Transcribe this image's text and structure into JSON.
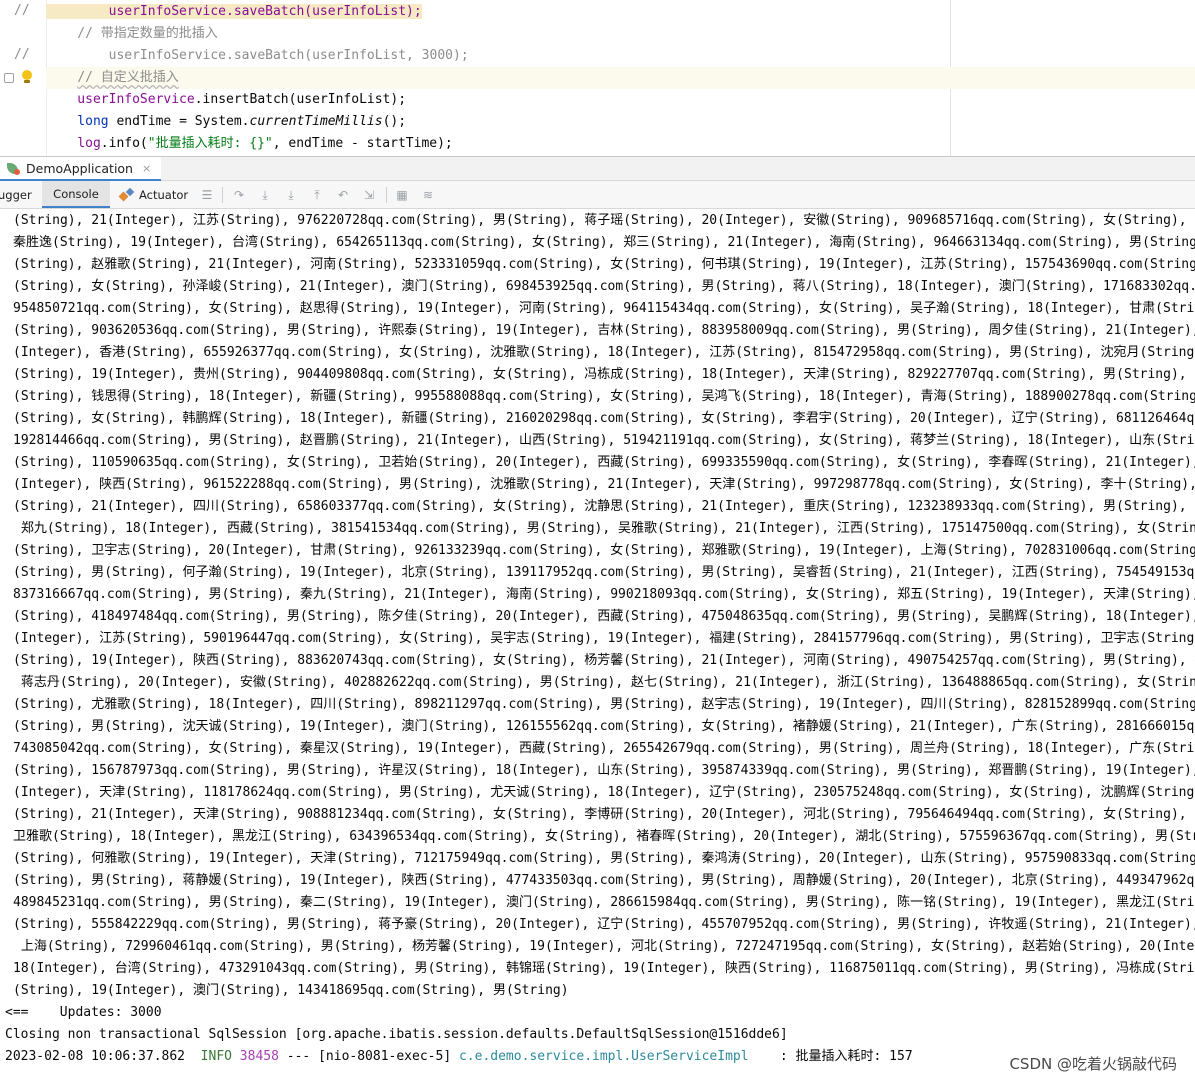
{
  "editor": {
    "lines": [
      {
        "gutter": "//",
        "parts": [
          {
            "cls": "c-field c-hl",
            "text": "        userInfoService.saveBatch(userInfoList);"
          }
        ]
      },
      {
        "gutter": "",
        "parts": [
          {
            "cls": "c-comment",
            "text": "    // 带指定数量的批插入"
          }
        ]
      },
      {
        "gutter": "//",
        "parts": [
          {
            "cls": "c-comment",
            "text": "        userInfoService.saveBatch(userInfoList, 3000);"
          }
        ]
      },
      {
        "gutter": "",
        "current": true,
        "parts": [
          {
            "cls": "c-comment",
            "text": "    "
          },
          {
            "cls": "c-comment squiggle",
            "text": "// 自定义批插入"
          }
        ]
      },
      {
        "gutter": "",
        "parts": [
          {
            "cls": "c-field",
            "text": "    userInfoService"
          },
          {
            "cls": "c-plain",
            "text": ".insertBatch(userInfoList);"
          }
        ]
      },
      {
        "gutter": "",
        "parts": [
          {
            "cls": "c-kw",
            "text": "    long"
          },
          {
            "cls": "c-plain",
            "text": " endTime = System."
          },
          {
            "cls": "c-static",
            "text": "currentTimeMillis"
          },
          {
            "cls": "c-plain",
            "text": "();"
          }
        ]
      },
      {
        "gutter": "",
        "parts": [
          {
            "cls": "c-field",
            "text": "    log"
          },
          {
            "cls": "c-plain",
            "text": ".info("
          },
          {
            "cls": "c-str",
            "text": "\"批量插入耗时: {}\""
          },
          {
            "cls": "c-plain",
            "text": ", endTime - startTime);"
          }
        ]
      }
    ]
  },
  "run_tab": {
    "label": "DemoApplication",
    "close": "×"
  },
  "tool_tabs": {
    "debugger": "ugger",
    "console": "Console",
    "actuator": "Actuator"
  },
  "console_lines": [
    "(String), 21(Integer), 江苏(String), 976220728qq.com(String), 男(String), 蒋子瑶(String), 20(Integer), 安徽(String), 909685716qq.com(String), 女(String), 孙",
    "秦胜逸(String), 19(Integer), 台湾(String), 654265113qq.com(String), 女(String), 郑三(String), 21(Integer), 海南(String), 964663134qq.com(String), 男(String",
    "(String), 赵雅歌(String), 21(Integer), 河南(String), 523331059qq.com(String), 女(String), 何书琪(String), 19(Integer), 江苏(String), 157543690qq.com(String",
    "(String), 女(String), 孙泽峻(String), 21(Integer), 澳门(String), 698453925qq.com(String), 男(String), 蒋八(String), 18(Integer), 澳门(String), 171683302qq.c",
    "954850721qq.com(String), 女(String), 赵思得(String), 19(Integer), 河南(String), 964115434qq.com(String), 女(String), 吴子瀚(String), 18(Integer), 甘肃(Strin",
    "(String), 903620536qq.com(String), 男(String), 许熙泰(String), 19(Integer), 吉林(String), 883958009qq.com(String), 男(String), 周夕佳(String), 21(Integer),",
    "(Integer), 香港(String), 655926377qq.com(String), 女(String), 沈雅歌(String), 18(Integer), 江苏(String), 815472958qq.com(String), 男(String), 沈宛月(String)",
    "(String), 19(Integer), 贵州(String), 904409808qq.com(String), 女(String), 冯栋成(String), 18(Integer), 天津(String), 829227707qq.com(String), 男(String), 丁",
    "(String), 钱思得(String), 18(Integer), 新疆(String), 995588088qq.com(String), 女(String), 吴鸿飞(String), 18(Integer), 青海(String), 188900278qq.com(String",
    "(String), 女(String), 韩鹏辉(String), 18(Integer), 新疆(String), 216020298qq.com(String), 女(String), 李君宇(String), 20(Integer), 辽宁(String), 681126464qq",
    "192814466qq.com(String), 男(String), 赵晋鹏(String), 21(Integer), 山西(String), 519421191qq.com(String), 女(String), 蒋梦兰(String), 18(Integer), 山东(Strin",
    "(String), 110590635qq.com(String), 女(String), 卫若始(String), 20(Integer), 西藏(String), 699335590qq.com(String), 女(String), 李春晖(String), 21(Integer),",
    "(Integer), 陕西(String), 961522288qq.com(String), 男(String), 沈雅歌(String), 21(Integer), 天津(String), 997298778qq.com(String), 女(String), 李十(String),",
    "(String), 21(Integer), 四川(String), 658603377qq.com(String), 女(String), 沈静思(String), 21(Integer), 重庆(String), 123238933qq.com(String), 男(String), 吴",
    " 郑九(String), 18(Integer), 西藏(String), 381541534qq.com(String), 男(String), 吴雅歌(String), 21(Integer), 江西(String), 175147500qq.com(String), 女(Strin",
    "(String), 卫宇志(String), 20(Integer), 甘肃(String), 926133239qq.com(String), 女(String), 郑雅歌(String), 19(Integer), 上海(String), 702831006qq.com(String",
    "(String), 男(String), 何子瀚(String), 19(Integer), 北京(String), 139117952qq.com(String), 男(String), 吴睿哲(String), 21(Integer), 江西(String), 754549153qq",
    "837316667qq.com(String), 男(String), 秦九(String), 21(Integer), 海南(String), 990218093qq.com(String), 女(String), 郑五(String), 19(Integer), 天津(String),",
    "(String), 418497484qq.com(String), 男(String), 陈夕佳(String), 20(Integer), 西藏(String), 475048635qq.com(String), 男(String), 吴鹏辉(String), 18(Integer),",
    "(Integer), 江苏(String), 590196447qq.com(String), 女(String), 吴宇志(String), 19(Integer), 福建(String), 284157796qq.com(String), 男(String), 卫宇志(String)",
    "(String), 19(Integer), 陕西(String), 883620743qq.com(String), 女(String), 杨芳馨(String), 21(Integer), 河南(String), 490754257qq.com(String), 男(String), 钱",
    " 蒋志丹(String), 20(Integer), 安徽(String), 402882622qq.com(String), 男(String), 赵七(String), 21(Integer), 浙江(String), 136488865qq.com(String), 女(Strin",
    "(String), 尤雅歌(String), 18(Integer), 四川(String), 898211297qq.com(String), 男(String), 赵宇志(String), 19(Integer), 四川(String), 828152899qq.com(String",
    "(String), 男(String), 沈天诚(String), 19(Integer), 澳门(String), 126155562qq.com(String), 女(String), 褚静媛(String), 21(Integer), 广东(String), 281666015qq",
    "743085042qq.com(String), 女(String), 秦星汉(String), 19(Integer), 西藏(String), 265542679qq.com(String), 男(String), 周兰舟(String), 18(Integer), 广东(Strin",
    "(String), 156787973qq.com(String), 男(String), 许星汉(String), 18(Integer), 山东(String), 395874339qq.com(String), 男(String), 郑晋鹏(String), 19(Integer),",
    "(Integer), 天津(String), 118178624qq.com(String), 男(String), 尤天诚(String), 18(Integer), 辽宁(String), 230575248qq.com(String), 女(String), 沈鹏辉(String)",
    "(String), 21(Integer), 天津(String), 908881234qq.com(String), 女(String), 李博研(String), 20(Integer), 河北(String), 795646494qq.com(String), 女(String), 陈",
    "卫雅歌(String), 18(Integer), 黑龙江(String), 634396534qq.com(String), 女(String), 褚春晖(String), 20(Integer), 湖北(String), 575596367qq.com(String), 男(Str",
    "(String), 何雅歌(String), 19(Integer), 天津(String), 712175949qq.com(String), 男(String), 秦鸿涛(String), 20(Integer), 山东(String), 957590833qq.com(String",
    "(String), 男(String), 蒋静媛(String), 19(Integer), 陕西(String), 477433503qq.com(String), 男(String), 周静媛(String), 20(Integer), 北京(String), 449347962qq",
    "489845231qq.com(String), 男(String), 秦二(String), 19(Integer), 澳门(String), 286615984qq.com(String), 男(String), 陈一铭(String), 19(Integer), 黑龙江(Strin",
    "(String), 555842229qq.com(String), 男(String), 蒋予豪(String), 20(Integer), 辽宁(String), 455707952qq.com(String), 男(String), 许牧遥(String), 21(Integer),",
    " 上海(String), 729960461qq.com(String), 男(String), 杨芳馨(String), 19(Integer), 河北(String), 727247195qq.com(String), 女(String), 赵若始(String), 20(Integ",
    "18(Integer), 台湾(String), 473291043qq.com(String), 男(String), 韩锦瑶(String), 19(Integer), 陕西(String), 116875011qq.com(String), 男(String), 冯栋成(Strin",
    "(String), 19(Integer), 澳门(String), 143418695qq.com(String), 男(String)"
  ],
  "tail": {
    "updates": "<==    Updates: 3000",
    "closing": "Closing non transactional SqlSession [org.apache.ibatis.session.defaults.DefaultSqlSession@1516dde6]",
    "log_timestamp": "2023-02-08 10:06:37.862  ",
    "log_level": "INFO",
    "log_pid": " 38458",
    "log_thread": " --- [nio-8081-exec-5] ",
    "log_class": "c.e.demo.service.impl.UserServiceImpl",
    "log_message": "    : 批量插入耗时: 157"
  },
  "watermark": "CSDN @吃着火锅敲代码"
}
